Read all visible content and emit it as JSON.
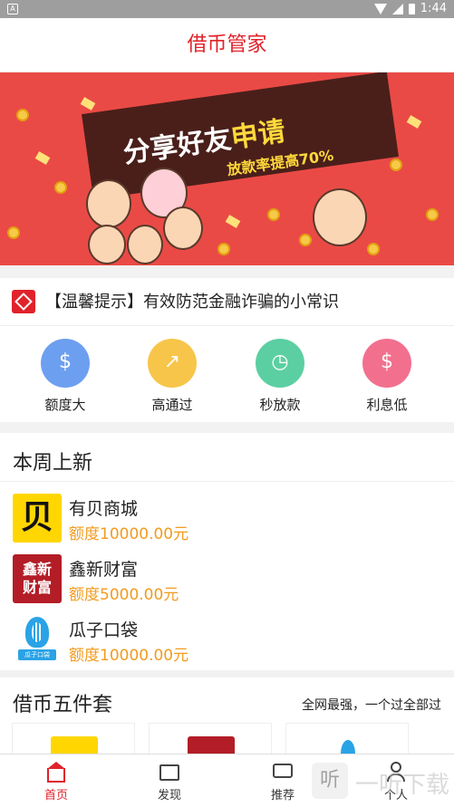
{
  "status_bar": {
    "time": "1:44"
  },
  "header": {
    "title": "借币管家"
  },
  "banner": {
    "title_part1": "分享",
    "title_part2": "好友",
    "title_part3": "申请",
    "subtitle": "放款率提高70%"
  },
  "notice": {
    "text": "【温馨提示】有效防范金融诈骗的小常识"
  },
  "features": [
    {
      "label": "额度大",
      "icon": "coin-stack-icon",
      "color": "#6d9ff0"
    },
    {
      "label": "高通过",
      "icon": "chart-up-icon",
      "color": "#f7c549"
    },
    {
      "label": "秒放款",
      "icon": "clock-icon",
      "color": "#5ccfa2"
    },
    {
      "label": "利息低",
      "icon": "money-bag-icon",
      "color": "#f2708e"
    }
  ],
  "weekly": {
    "title": "本周上新",
    "items": [
      {
        "name": "有贝商城",
        "amount": "额度10000.00元",
        "logo_text": "贝"
      },
      {
        "name": "鑫新财富",
        "amount": "额度5000.00元",
        "logo_text": "鑫新财富"
      },
      {
        "name": "瓜子口袋",
        "amount": "额度10000.00元",
        "logo_text": "瓜子口袋"
      }
    ]
  },
  "five": {
    "title": "借币五件套",
    "subtitle": "全网最强，一个过全部过"
  },
  "tabbar": [
    {
      "label": "首页",
      "icon": "home-icon",
      "active": true
    },
    {
      "label": "发现",
      "icon": "shop-icon",
      "active": false
    },
    {
      "label": "推荐",
      "icon": "chat-icon",
      "active": false
    },
    {
      "label": "个人",
      "icon": "person-icon",
      "active": false
    }
  ],
  "watermark": {
    "text": "一听下载",
    "icon_text": "听"
  },
  "colors": {
    "brand": "#e0222a",
    "amount": "#f19b1f",
    "banner_bg": "#ea4a46"
  }
}
